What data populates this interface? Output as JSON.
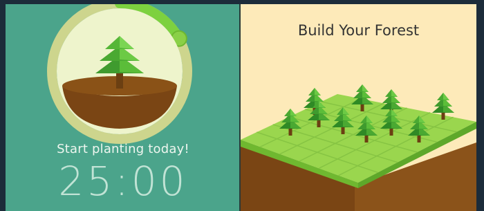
{
  "left_panel": {
    "tagline": "Start planting today!",
    "timer": "25:00",
    "progress_fraction": 0.17
  },
  "right_panel": {
    "headline": "Build Your Forest"
  },
  "colors": {
    "left_bg": "#4ba48b",
    "right_bg": "#fdeab9",
    "progress_ring": "#7dd13f",
    "tree": "#3f9b2e",
    "soil": "#7a4514",
    "grass": "#8ad047"
  },
  "icons": [
    "tree-icon",
    "progress-knob-icon",
    "forest-grid-icon"
  ]
}
